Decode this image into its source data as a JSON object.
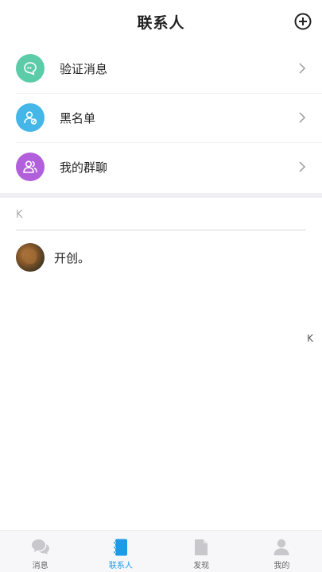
{
  "header": {
    "title": "联系人"
  },
  "entries": [
    {
      "label": "验证消息",
      "icon": "verify-message-icon",
      "color": "#5ccca8"
    },
    {
      "label": "黑名单",
      "icon": "blacklist-icon",
      "color": "#45b6e8"
    },
    {
      "label": "我的群聊",
      "icon": "group-chat-icon",
      "color": "#b15fdb"
    }
  ],
  "contacts": {
    "group_letter": "K",
    "items": [
      {
        "name": "开创。"
      }
    ]
  },
  "side_index": {
    "letters": [
      "K"
    ]
  },
  "bottom_nav": {
    "items": [
      {
        "label": "消息",
        "icon": "messages-icon"
      },
      {
        "label": "联系人",
        "icon": "contacts-icon",
        "active": true
      },
      {
        "label": "发现",
        "icon": "discover-icon"
      },
      {
        "label": "我的",
        "icon": "profile-icon"
      }
    ],
    "active_color": "#1e9be8",
    "inactive_color": "#c8c8cc"
  }
}
